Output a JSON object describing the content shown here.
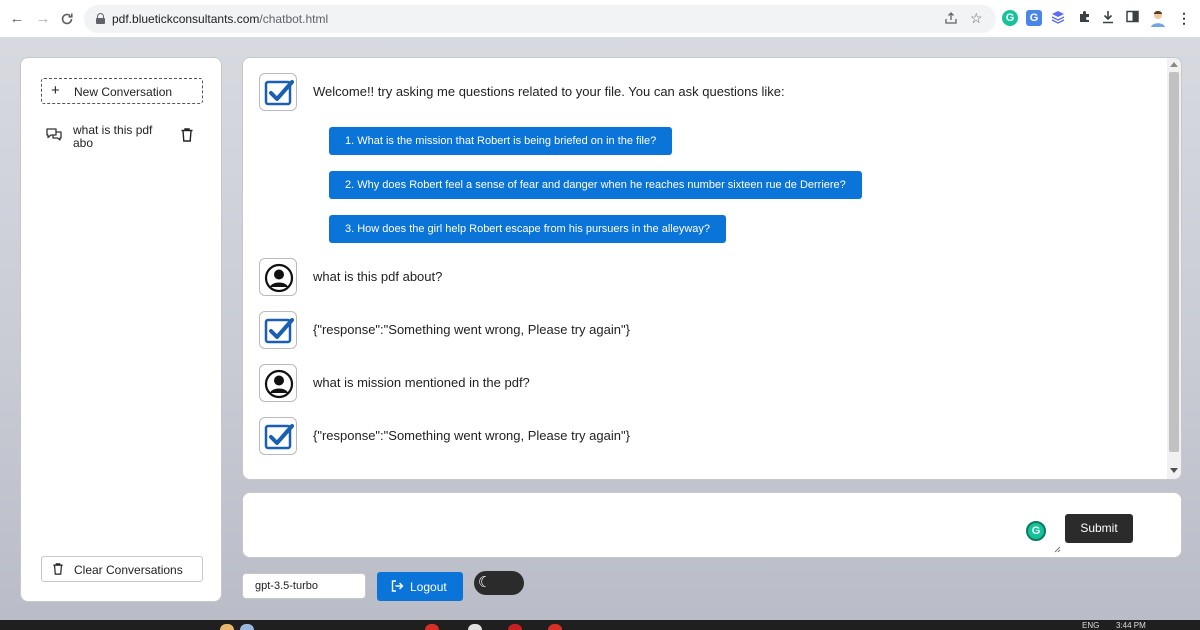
{
  "browser": {
    "url_domain": "pdf.bluetickconsultants.com",
    "url_path": "/chatbot.html",
    "nav_back": "←",
    "nav_forward": "→",
    "nav_reload": "C"
  },
  "sidebar": {
    "new_conversation_label": "New Conversation",
    "conversations": [
      {
        "title": "what is this pdf abo"
      }
    ],
    "clear_label": "Clear Conversations"
  },
  "chat": {
    "messages": [
      {
        "role": "bot",
        "text": "Welcome!! try asking me questions related to your file. You can ask questions like:"
      },
      {
        "role": "user",
        "text": "what is this pdf about?"
      },
      {
        "role": "bot",
        "text": "{\"response\":\"Something went wrong, Please try again\"}"
      },
      {
        "role": "user",
        "text": "what is mission mentioned in the pdf?"
      },
      {
        "role": "bot",
        "text": "{\"response\":\"Something went wrong, Please try again\"}"
      }
    ],
    "suggestions": [
      "1. What is the mission that Robert is being briefed on in the file?",
      "2. Why does Robert feel a sense of fear and danger when he reaches number sixteen rue de Derriere?",
      "3. How does the girl help Robert escape from his pursuers in the alleyway?"
    ]
  },
  "composer": {
    "input_value": "",
    "submit_label": "Submit"
  },
  "controls": {
    "model": "gpt-3.5-turbo",
    "logout_label": "Logout"
  },
  "taskbar": {
    "lang": "ENG",
    "time": "3:44 PM"
  },
  "colors": {
    "accent": "#0b74d9",
    "dark_button": "#2b2b2b",
    "bot_check": "#1a5fb4"
  }
}
